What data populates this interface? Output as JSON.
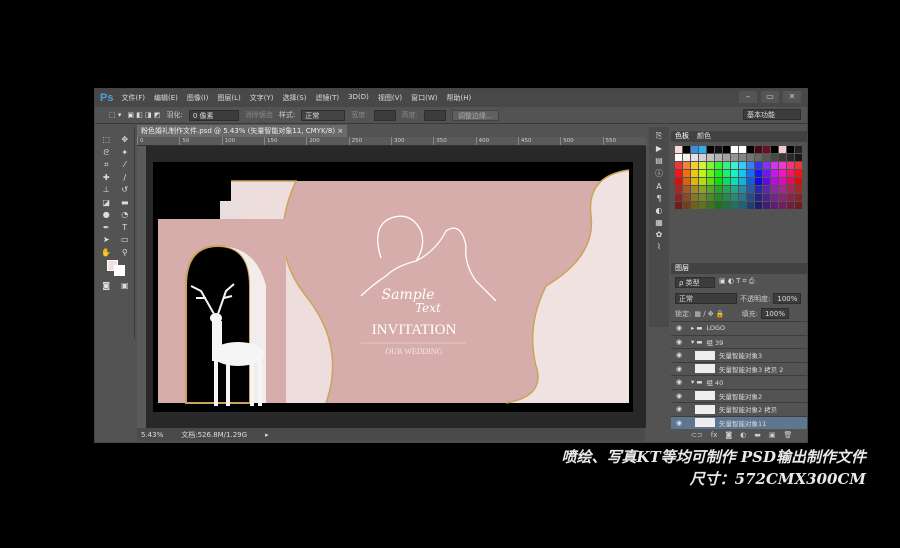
{
  "app": {
    "logo": "Ps",
    "menus": [
      "文件(F)",
      "编辑(E)",
      "图像(I)",
      "图层(L)",
      "文字(Y)",
      "选择(S)",
      "滤镜(T)",
      "3D(D)",
      "视图(V)",
      "窗口(W)",
      "帮助(H)"
    ],
    "window_controls": [
      "–",
      "▭",
      "✕"
    ]
  },
  "options": {
    "feather_label": "羽化:",
    "feather_value": "0 像素",
    "antialias": "消除锯齿",
    "style_label": "样式:",
    "style_value": "正常",
    "width_label": "宽度:",
    "height_label": "高度:",
    "refine_edge": "调整边缘...",
    "workspace": "基本功能"
  },
  "document": {
    "tab_title": "粉色婚礼制作文件.psd @ 5.43% (矢量智能对象11, CMYK/8)",
    "close": "×",
    "ruler_ticks": [
      "0",
      "50",
      "100",
      "150",
      "200",
      "250",
      "300",
      "350",
      "400",
      "450",
      "500",
      "550"
    ],
    "zoom": "5.43%",
    "doc_size": "文档:526.8M/1.29G"
  },
  "artwork": {
    "script_line1": "Sample",
    "script_line2": "Text",
    "title": "INVITATION",
    "subtitle": "OUR WEDDING",
    "colors": {
      "pink": "#d6adab",
      "marble": "#f1e2e2",
      "gold": "#c9a45a"
    }
  },
  "swatches_panel": {
    "tabs": [
      "色板",
      "颜色"
    ]
  },
  "layers_panel": {
    "title": "图层",
    "filter": "ρ 类型",
    "blend": "正常",
    "opacity_label": "不透明度:",
    "opacity": "100%",
    "lock_label": "锁定:",
    "fill_label": "填充:",
    "fill": "100%",
    "layers": [
      {
        "name": "LOGO",
        "type": "group",
        "indent": 0
      },
      {
        "name": "组 39",
        "type": "group-open",
        "indent": 0
      },
      {
        "name": "矢量智能对象3",
        "type": "layer"
      },
      {
        "name": "矢量智能对象3 拷贝 2",
        "type": "layer"
      },
      {
        "name": "组 40",
        "type": "group-open",
        "indent": 0
      },
      {
        "name": "矢量智能对象2",
        "type": "layer"
      },
      {
        "name": "矢量智能对象2 拷贝",
        "type": "layer"
      },
      {
        "name": "矢量智能对象11",
        "type": "layer",
        "selected": true
      }
    ],
    "footer_icons": [
      "link-icon",
      "fx-icon",
      "mask-icon",
      "adjustment-icon",
      "folder-icon",
      "new-layer-icon",
      "trash-icon"
    ]
  },
  "caption": {
    "line1": "喷绘、写真KT等均可制作   PSD输出制作文件",
    "line2": "尺寸：572CMX300CM"
  }
}
